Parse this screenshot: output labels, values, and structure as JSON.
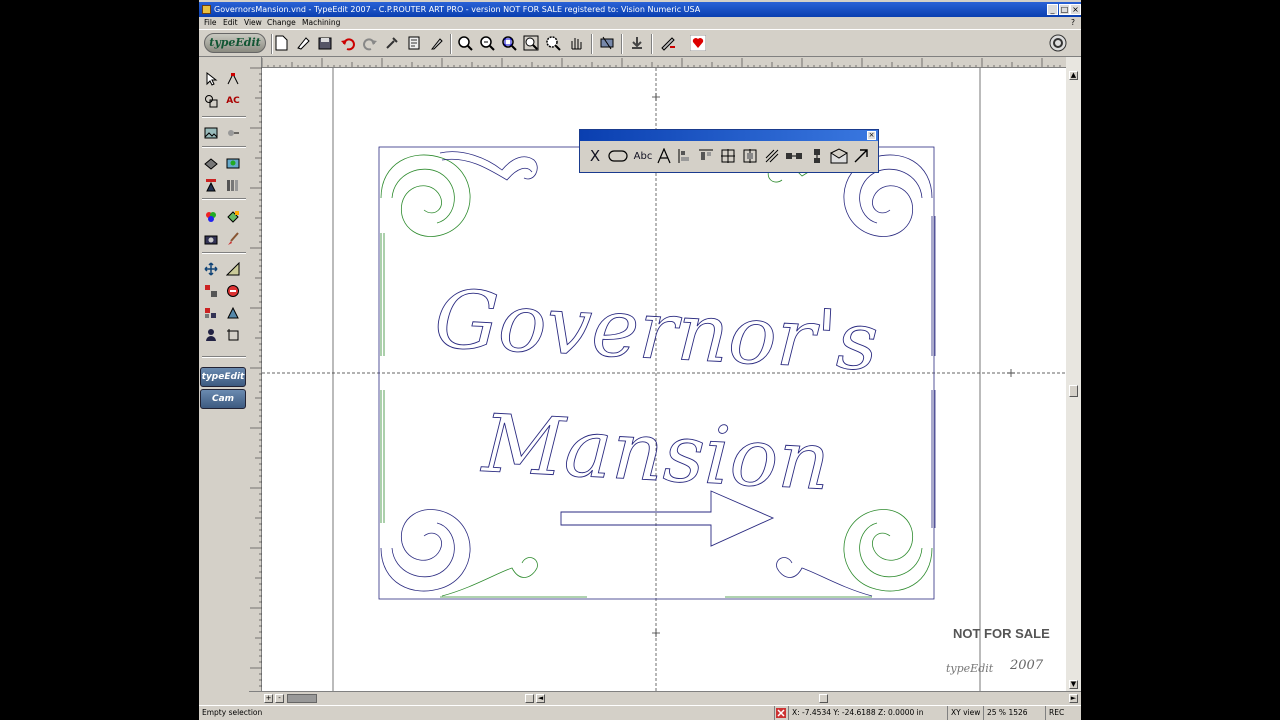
{
  "window": {
    "title": "GovernorsMansion.vnd - TypeEdit 2007 - C.P.ROUTER ART PRO - version NOT FOR SALE registered to: Vision Numeric USA",
    "controls": [
      "_",
      "□",
      "×"
    ]
  },
  "menu": {
    "items": [
      "File",
      "Edit",
      "View",
      "Change",
      "Machining"
    ],
    "help": "?"
  },
  "toolbar": {
    "logo": "typeEdit",
    "icons": [
      "new-document-icon",
      "open-icon",
      "save-icon",
      "undo-icon",
      "redo-icon",
      "tools-icon",
      "print-icon",
      "plot-icon",
      "zoom-in-icon",
      "zoom-out-icon",
      "zoom-window-icon",
      "zoom-page-icon",
      "zoom-all-icon",
      "pan-hand-icon",
      "cut-output-icon",
      "exit-icon",
      "machining-icon",
      "heart-icon",
      "help-icon"
    ]
  },
  "left_tabs": {
    "typeedit": "typeEdit",
    "cam": "Cam"
  },
  "float_toolbar": {
    "abc_label": "Abc"
  },
  "canvas": {
    "title_line1": "Governor's",
    "title_line2": "Mansion",
    "accent_green": "#2e8b2e",
    "accent_blue": "#2a2a80"
  },
  "watermark": {
    "not_for_sale": "NOT FOR SALE",
    "logo": "typeEdit",
    "year": "2007"
  },
  "statusbar": {
    "message": "Empty selection",
    "coords": "X: -7.4534   Y: -24.6188  Z: 0.0000 in",
    "view": "XY view",
    "zoom": "25 % 1526",
    "rec": "REC"
  }
}
